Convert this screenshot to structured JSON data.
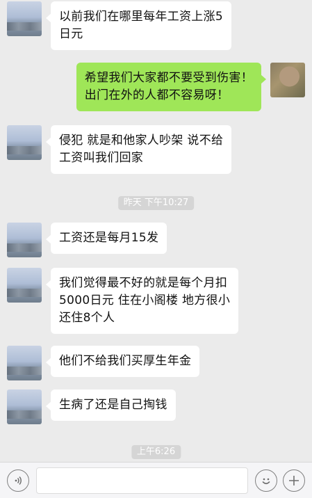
{
  "messages": [
    {
      "side": "left",
      "lines": [
        "以前我们在哪里每年工资上涨5",
        "日元"
      ]
    },
    {
      "side": "right",
      "lines": [
        "希望我们大家都不要受到伤害！",
        "出门在外的人都不容易呀！"
      ]
    },
    {
      "side": "left",
      "lines": [
        "侵犯 就是和他家人吵架 说不给",
        "工资叫我们回家"
      ]
    },
    {
      "side": "left",
      "lines": [
        "工资还是每月15发"
      ]
    },
    {
      "side": "left",
      "lines": [
        "我们觉得最不好的就是每个月扣",
        "5000日元 住在小阁楼 地方很小",
        "还住8个人"
      ]
    },
    {
      "side": "left",
      "lines": [
        "他们不给我们买厚生年金"
      ]
    },
    {
      "side": "left",
      "lines": [
        "生病了还是自己掏钱"
      ]
    }
  ],
  "timestamps": [
    "昨天 下午10:27",
    "上午6:26"
  ],
  "colors": {
    "background": "#ebebeb",
    "incoming_bubble": "#ffffff",
    "outgoing_bubble": "#9fe658",
    "timestamp_bg": "#d5d5d5"
  },
  "icons": {
    "voice": "voice-icon",
    "emoji": "emoji-icon",
    "plus": "plus-icon"
  }
}
